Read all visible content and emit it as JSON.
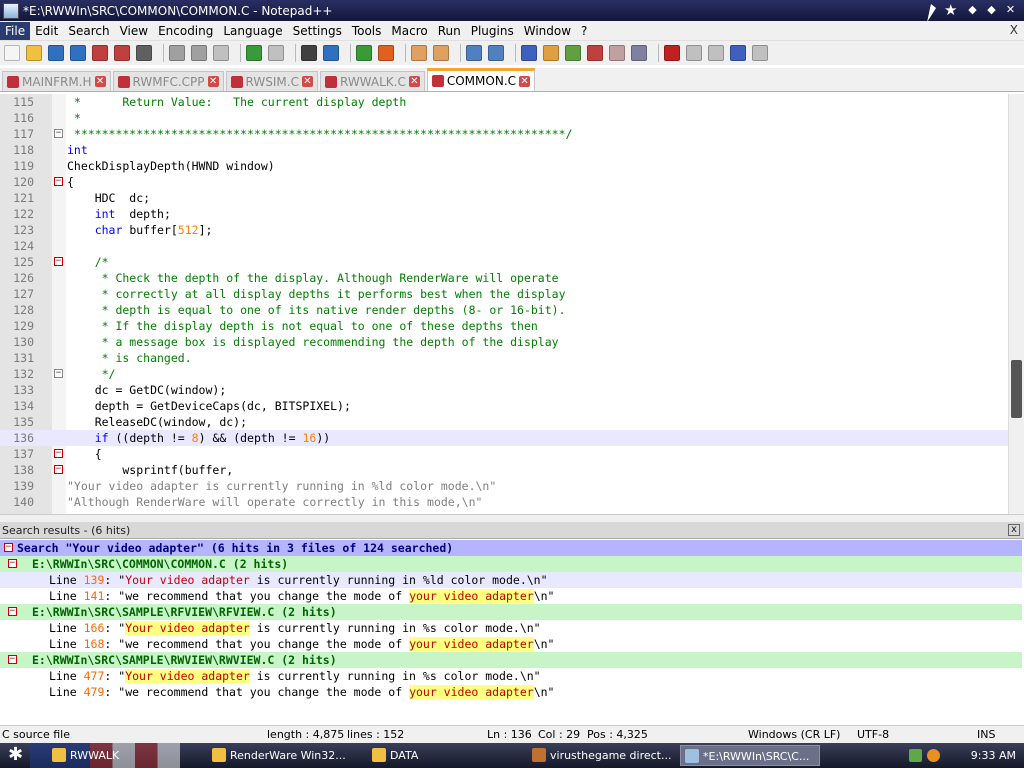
{
  "window": {
    "title": "*E:\\RWWIn\\SRC\\COMMON\\COMMON.C - Notepad++",
    "controls": [
      "✕",
      "◆",
      "◆",
      "✕"
    ]
  },
  "menu": [
    "File",
    "Edit",
    "Search",
    "View",
    "Encoding",
    "Language",
    "Settings",
    "Tools",
    "Macro",
    "Run",
    "Plugins",
    "Window",
    "?"
  ],
  "menu_close": "X",
  "tabs": [
    {
      "label": "MAINFRM.H",
      "active": false
    },
    {
      "label": "RWMFC.CPP",
      "active": false
    },
    {
      "label": "RWSIM.C",
      "active": false
    },
    {
      "label": "RWWALK.C",
      "active": false
    },
    {
      "label": "COMMON.C",
      "active": true
    }
  ],
  "editor": {
    "lines": [
      {
        "n": "115",
        "t": " *      Return Value:   The current display depth",
        "cls": "c-comment"
      },
      {
        "n": "116",
        "t": " *",
        "cls": "c-comment"
      },
      {
        "n": "117",
        "t": " ***********************************************************************/",
        "cls": "c-comment"
      },
      {
        "n": "118",
        "t": "int",
        "cls": "c-kw"
      },
      {
        "n": "119",
        "t": "CheckDisplayDepth(HWND window)",
        "cls": ""
      },
      {
        "n": "120",
        "t": "{",
        "cls": ""
      },
      {
        "n": "121",
        "t": "    HDC  dc;",
        "cls": ""
      },
      {
        "n": "122",
        "t": "    int  depth;",
        "cls": ""
      },
      {
        "n": "123",
        "t": "    char buffer[512];",
        "cls": ""
      },
      {
        "n": "124",
        "t": "",
        "cls": ""
      },
      {
        "n": "125",
        "t": "    /*",
        "cls": "c-comment"
      },
      {
        "n": "126",
        "t": "     * Check the depth of the display. Although RenderWare will operate",
        "cls": "c-comment"
      },
      {
        "n": "127",
        "t": "     * correctly at all display depths it performs best when the display",
        "cls": "c-comment"
      },
      {
        "n": "128",
        "t": "     * depth is equal to one of its native render depths (8- or 16-bit).",
        "cls": "c-comment"
      },
      {
        "n": "129",
        "t": "     * If the display depth is not equal to one of these depths then",
        "cls": "c-comment"
      },
      {
        "n": "130",
        "t": "     * a message box is displayed recommending the depth of the display",
        "cls": "c-comment"
      },
      {
        "n": "131",
        "t": "     * is changed.",
        "cls": "c-comment"
      },
      {
        "n": "132",
        "t": "     */",
        "cls": "c-comment"
      },
      {
        "n": "133",
        "t": "    dc = GetDC(window);",
        "cls": ""
      },
      {
        "n": "134",
        "t": "    depth = GetDeviceCaps(dc, BITSPIXEL);",
        "cls": ""
      },
      {
        "n": "135",
        "t": "    ReleaseDC(window, dc);",
        "cls": ""
      },
      {
        "n": "136",
        "t": "    if ((depth != 8) && (depth != 16))",
        "cls": ""
      },
      {
        "n": "137",
        "t": "    {",
        "cls": ""
      },
      {
        "n": "138",
        "t": "        wsprintf(buffer,",
        "cls": ""
      },
      {
        "n": "139",
        "t": "\"Your video adapter is currently running in %ld color mode.\\n\"",
        "cls": "c-str"
      },
      {
        "n": "140",
        "t": "\"Although RenderWare will operate correctly in this mode,\\n\"",
        "cls": "c-str"
      }
    ]
  },
  "results_panel": {
    "title": "Search results - (6 hits)",
    "close": "x",
    "search_line": "Search \"Your video adapter\" (6 hits in 3 files of 124 searched)",
    "files": [
      {
        "path": "E:\\RWWIn\\SRC\\COMMON\\COMMON.C (2 hits)",
        "hits": [
          {
            "prefix": "Line ",
            "num": "139",
            "sep": ": \"",
            "match": "Your video adapter",
            "rest": " is currently running in %ld color mode.\\n\"",
            "style": "first"
          },
          {
            "prefix": "Line ",
            "num": "141",
            "sep": ": \"",
            "pre": "we recommend that you change the mode of ",
            "match": "your video adapter",
            "rest": "\\n\"",
            "style": "second"
          }
        ]
      },
      {
        "path": "E:\\RWWIn\\SRC\\SAMPLE\\RFVIEW\\RFVIEW.C (2 hits)",
        "hits": [
          {
            "prefix": "Line ",
            "num": "166",
            "sep": ": \"",
            "match": "Your video adapter",
            "rest": " is currently running in %s color mode.\\n\"",
            "style": "first"
          },
          {
            "prefix": "Line ",
            "num": "168",
            "sep": ": \"",
            "pre": "we recommend that you change the mode of ",
            "match": "your video adapter",
            "rest": "\\n\"",
            "style": "second"
          }
        ]
      },
      {
        "path": "E:\\RWWIn\\SRC\\SAMPLE\\RWVIEW\\RWVIEW.C (2 hits)",
        "hits": [
          {
            "prefix": "Line ",
            "num": "477",
            "sep": ": \"",
            "match": "Your video adapter",
            "rest": " is currently running in %s color mode.\\n\"",
            "style": "first"
          },
          {
            "prefix": "Line ",
            "num": "479",
            "sep": ": \"",
            "pre": "we recommend that you change the mode of ",
            "match": "your video adapter",
            "rest": "\\n\"",
            "style": "second"
          }
        ]
      }
    ]
  },
  "status": {
    "filetype": "C source file",
    "length": "length : 4,875",
    "lines": "lines : 152",
    "ln": "Ln : 136",
    "col": "Col : 29",
    "pos": "Pos : 4,325",
    "eol": "Windows (CR LF)",
    "encoding": "UTF-8",
    "mode": "INS"
  },
  "taskbar": {
    "tasks": [
      {
        "label": "RWWALK",
        "color": "#f0c040"
      },
      {
        "label": "RenderWare Win32...",
        "color": "#f0c040"
      },
      {
        "label": "DATA",
        "color": "#f0c040"
      },
      {
        "label": "virusthegame direct...",
        "color": "#c07030"
      },
      {
        "label": "*E:\\RWWIn\\SRC\\C...",
        "color": "#a0c0e0",
        "active": true
      }
    ],
    "clock": "9:33 AM"
  }
}
